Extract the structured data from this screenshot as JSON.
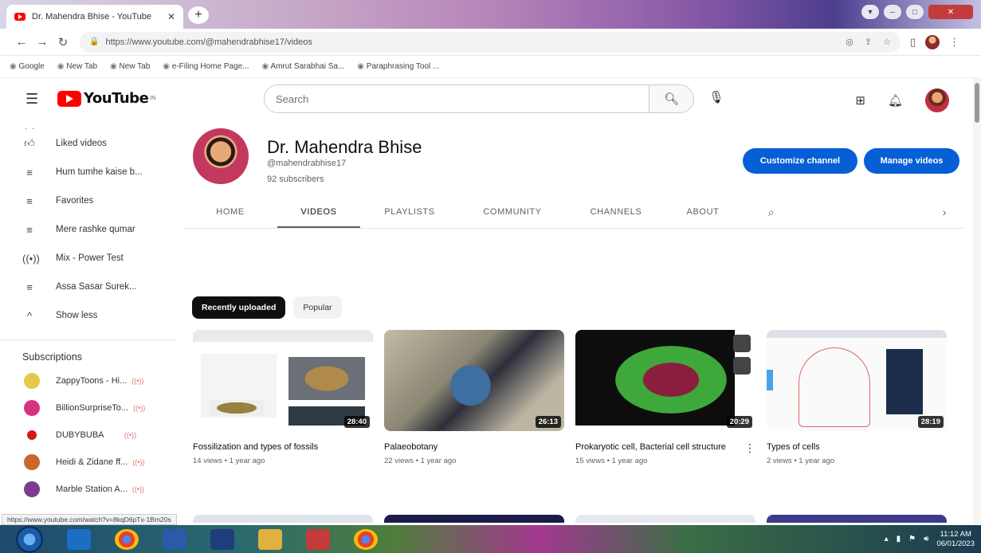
{
  "browser": {
    "tab_title": "Dr. Mahendra Bhise - YouTube",
    "tab_close": "✕",
    "new_tab": "+",
    "url": "https://www.youtube.com/@mahendrabhise17/videos",
    "bookmarks": [
      "Google",
      "New Tab",
      "New Tab",
      "e-Filing Home Page...",
      "Amrut Sarabhai Sa...",
      "Paraphrasing Tool ..."
    ]
  },
  "youtube": {
    "logo_text": "YouTube",
    "logo_sup": "IN",
    "search_placeholder": "Search"
  },
  "sidebar": {
    "items": [
      {
        "label": "Liked videos",
        "icon": "thumb-up-icon"
      },
      {
        "label": "Hum tumhe kaise b...",
        "icon": "playlist-icon"
      },
      {
        "label": "Favorites",
        "icon": "playlist-icon"
      },
      {
        "label": "Mere rashke qumar",
        "icon": "playlist-icon"
      },
      {
        "label": "Mix - Power Test",
        "icon": "mix-icon"
      },
      {
        "label": "Assa Sasar Surek...",
        "icon": "playlist-icon"
      },
      {
        "label": "Show less",
        "icon": "chevron-up-icon"
      }
    ],
    "subscriptions_heading": "Subscriptions",
    "subscriptions": [
      {
        "label": "ZappyToons - Hi...",
        "color": "#e8c84a"
      },
      {
        "label": "BillionSurpriseTo...",
        "color": "#d6327d"
      },
      {
        "label": "DUBYBUBA",
        "color": "#d11a1a"
      },
      {
        "label": "Heidi & Zidane ff...",
        "color": "#c9682a"
      },
      {
        "label": "Marble Station A...",
        "color": "#7a3e8c"
      }
    ],
    "live_mark": "((•))"
  },
  "channel": {
    "name": "Dr. Mahendra Bhise",
    "handle": "@mahendrabhise17",
    "subscribers": "92 subscribers",
    "customize_label": "Customize channel",
    "manage_label": "Manage videos",
    "tabs": [
      "HOME",
      "VIDEOS",
      "PLAYLISTS",
      "COMMUNITY",
      "CHANNELS",
      "ABOUT"
    ],
    "active_tab": "VIDEOS"
  },
  "chips": [
    "Recently uploaded",
    "Popular"
  ],
  "videos": [
    {
      "title": "Fossilization and types of fossils",
      "meta": "14 views • 1 year ago",
      "duration": "28:40"
    },
    {
      "title": "Palaeobotany",
      "meta": "22 views • 1 year ago",
      "duration": "26:13"
    },
    {
      "title": "Prokaryotic cell, Bacterial cell structure",
      "meta": "15 views • 1 year ago",
      "duration": "20:29"
    },
    {
      "title": "Types of cells",
      "meta": "2 views • 1 year ago",
      "duration": "28:19"
    }
  ],
  "status_url": "https://www.youtube.com/watch?v=8kqD6pTx-1Bm20s",
  "taskbar": {
    "time": "11:12 AM",
    "date": "06/01/2023"
  },
  "colors": {
    "accent_blue": "#065fd4",
    "youtube_red": "#ff0000"
  }
}
